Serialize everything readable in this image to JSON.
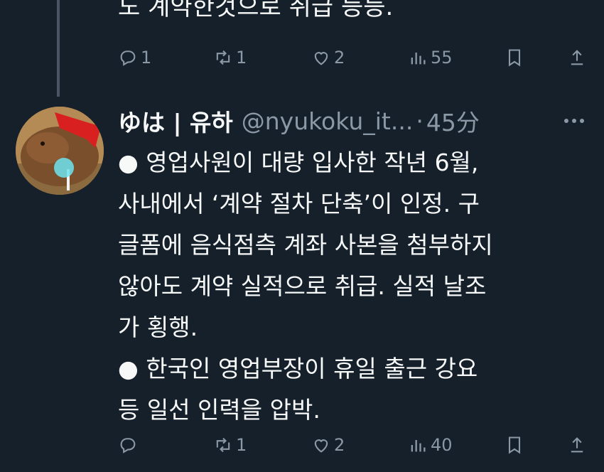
{
  "previous_tweet": {
    "text_tail": "도 계약한것으로 취급 등등.",
    "actions": {
      "replies": "1",
      "retweets": "1",
      "likes": "2",
      "views": "55"
    }
  },
  "tweet": {
    "display_name": "ゆは | 유하",
    "handle": "@nyukoku_it...",
    "separator": "·",
    "time": "45分",
    "lines": [
      "● 영업사원이 대량 입사한 작년 6월,",
      "사내에서 ‘계약 절차 단축’이 인정. 구",
      "글폼에 음식점측 계좌 사본을 첨부하지",
      "않아도 계약 실적으로 취급. 실적 날조",
      "가 횡행.",
      "● 한국인 영업부장이 휴일 출근 강요",
      "등 일선 인력을 압박."
    ],
    "actions": {
      "replies": "",
      "retweets": "1",
      "likes": "2",
      "views": "40"
    }
  },
  "colors": {
    "background": "#15202b",
    "text": "#f7f9f9",
    "secondary": "#8b98a5"
  },
  "icons": [
    "reply-icon",
    "retweet-icon",
    "like-icon",
    "views-icon",
    "bookmark-icon",
    "share-icon",
    "more-icon"
  ]
}
